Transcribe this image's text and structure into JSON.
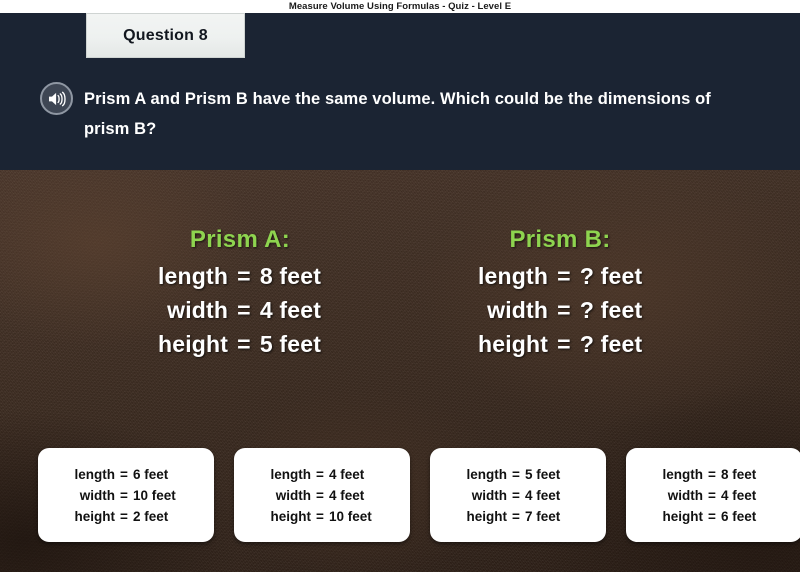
{
  "titlebar": {
    "title": "Measure Volume Using Formulas - Quiz - Level E"
  },
  "header": {
    "question_tab_label": "Question 8",
    "speaker_icon": "speaker-audio-icon",
    "question_text": "Prism A and Prism B have the same volume. Which could be the dimensions of prism B?",
    "background_color": "#1b2433",
    "tab_background_color": "#eef1f0"
  },
  "stage": {
    "background_color": "#3b2a1f",
    "accent_color": "#8ed44f",
    "prisms": [
      {
        "title": "Prism A:",
        "rows": [
          {
            "label": "length",
            "eq": "=",
            "value": "8 feet"
          },
          {
            "label": "width",
            "eq": "=",
            "value": "4 feet"
          },
          {
            "label": "height",
            "eq": "=",
            "value": "5 feet"
          }
        ]
      },
      {
        "title": "Prism B:",
        "rows": [
          {
            "label": "length",
            "eq": "=",
            "value": "? feet"
          },
          {
            "label": "width",
            "eq": "=",
            "value": "? feet"
          },
          {
            "label": "height",
            "eq": "=",
            "value": "? feet"
          }
        ]
      }
    ]
  },
  "options": [
    {
      "lines": [
        {
          "label": "length",
          "eq": "=",
          "value": "6 feet"
        },
        {
          "label": "width",
          "eq": "=",
          "value": "10 feet"
        },
        {
          "label": "height",
          "eq": "=",
          "value": "2 feet"
        }
      ]
    },
    {
      "lines": [
        {
          "label": "length",
          "eq": "=",
          "value": "4 feet"
        },
        {
          "label": "width",
          "eq": "=",
          "value": "4 feet"
        },
        {
          "label": "height",
          "eq": "=",
          "value": "10 feet"
        }
      ]
    },
    {
      "lines": [
        {
          "label": "length",
          "eq": "=",
          "value": "5 feet"
        },
        {
          "label": "width",
          "eq": "=",
          "value": "4 feet"
        },
        {
          "label": "height",
          "eq": "=",
          "value": "7 feet"
        }
      ]
    },
    {
      "lines": [
        {
          "label": "length",
          "eq": "=",
          "value": "8 feet"
        },
        {
          "label": "width",
          "eq": "=",
          "value": "4 feet"
        },
        {
          "label": "height",
          "eq": "=",
          "value": "6 feet"
        }
      ]
    }
  ]
}
